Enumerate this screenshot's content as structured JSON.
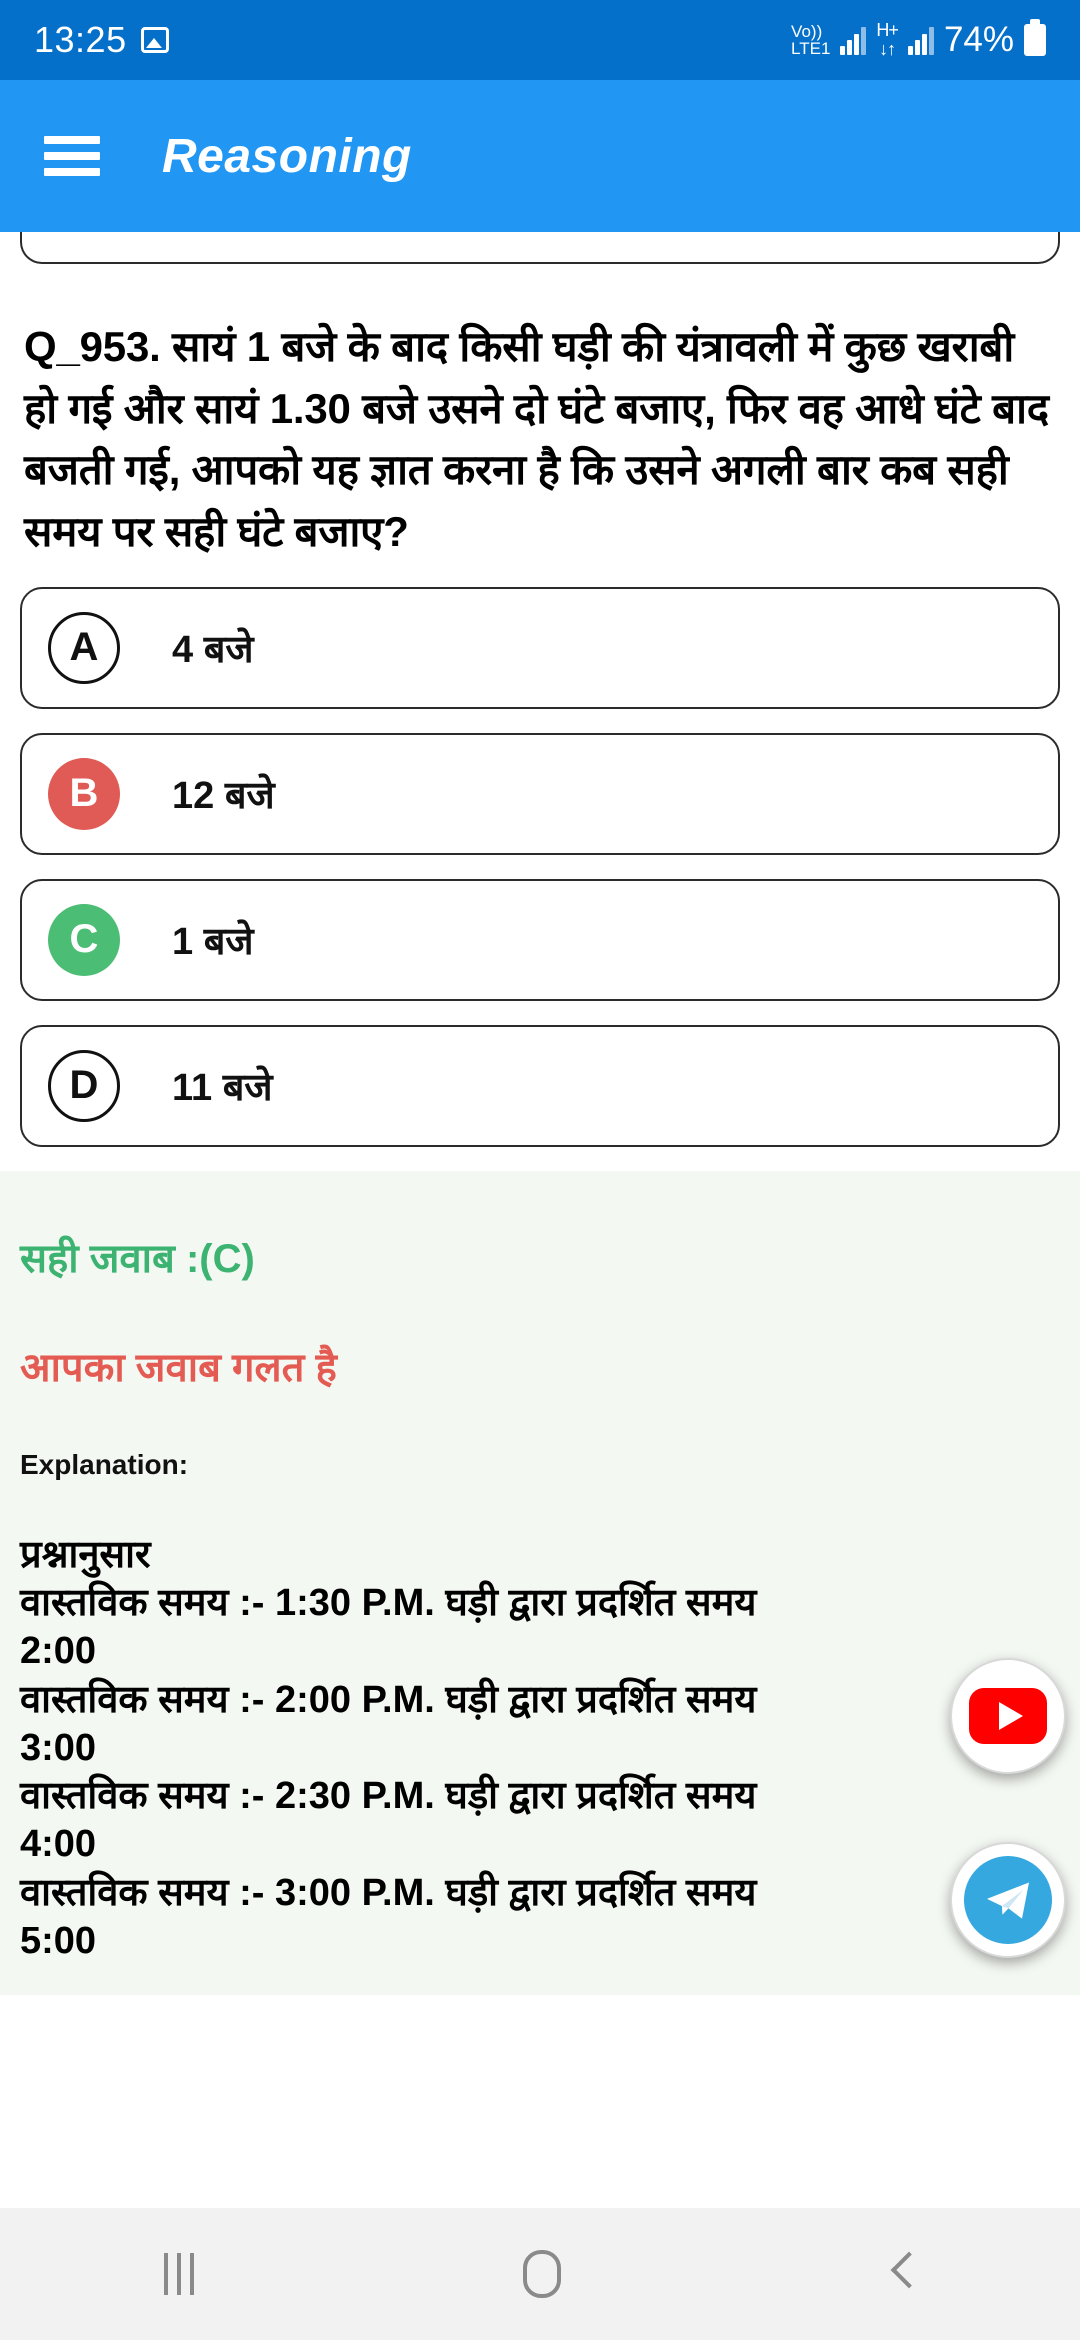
{
  "status_bar": {
    "time": "13:25",
    "image_icon": "image-icon",
    "volte_top": "Vo))",
    "volte_bottom": "LTE1",
    "network_type": "H+",
    "network_arrows": "↓↑",
    "battery_percent": "74%"
  },
  "app_bar": {
    "menu_icon": "hamburger-menu-icon",
    "title": "Reasoning"
  },
  "question": {
    "text": "Q_953. सायं 1 बजे के बाद किसी घड़ी की यंत्रावली में कुछ खराबी हो गई और सायं 1.30 बजे उसने दो घंटे बजाए, फिर वह आधे घंटे बाद बजती गई, आपको यह ज्ञात करना है कि उसने अगली बार कब सही समय पर सही घंटे बजाए?"
  },
  "options": [
    {
      "letter": "A",
      "text": "4 बजे",
      "state": "neutral"
    },
    {
      "letter": "B",
      "text": "12 बजे",
      "state": "wrong"
    },
    {
      "letter": "C",
      "text": "1 बजे",
      "state": "correct"
    },
    {
      "letter": "D",
      "text": "11 बजे",
      "state": "neutral"
    }
  ],
  "explanation": {
    "correct_answer": "सही जवाब :(C)",
    "user_result": "आपका जवाब गलत है",
    "label": "Explanation:",
    "lines": [
      "प्रश्नानुसार",
      "वास्तविक समय :- 1:30 P.M. घड़ी द्वारा प्रदर्शित समय",
      "2:00",
      "वास्तविक समय :- 2:00 P.M. घड़ी द्वारा प्रदर्शित समय",
      "3:00",
      "वास्तविक समय :- 2:30 P.M. घड़ी द्वारा प्रदर्शित समय",
      "4:00",
      "वास्तविक समय :- 3:00 P.M. घड़ी द्वारा प्रदर्शित समय",
      "5:00"
    ]
  },
  "fabs": [
    {
      "name": "youtube-fab",
      "icon": "youtube-icon"
    },
    {
      "name": "telegram-fab",
      "icon": "telegram-icon"
    }
  ],
  "nav_bar": {
    "recents": "recents-icon",
    "home": "home-icon",
    "back": "back-icon"
  },
  "colors": {
    "status_bar": "#0570C9",
    "app_bar": "#2196F3",
    "wrong": "#E05A56",
    "correct": "#4CBD74",
    "answer_green": "#3CB371",
    "answer_red": "#E35B52",
    "explanation_bg": "#F4F8F2"
  }
}
